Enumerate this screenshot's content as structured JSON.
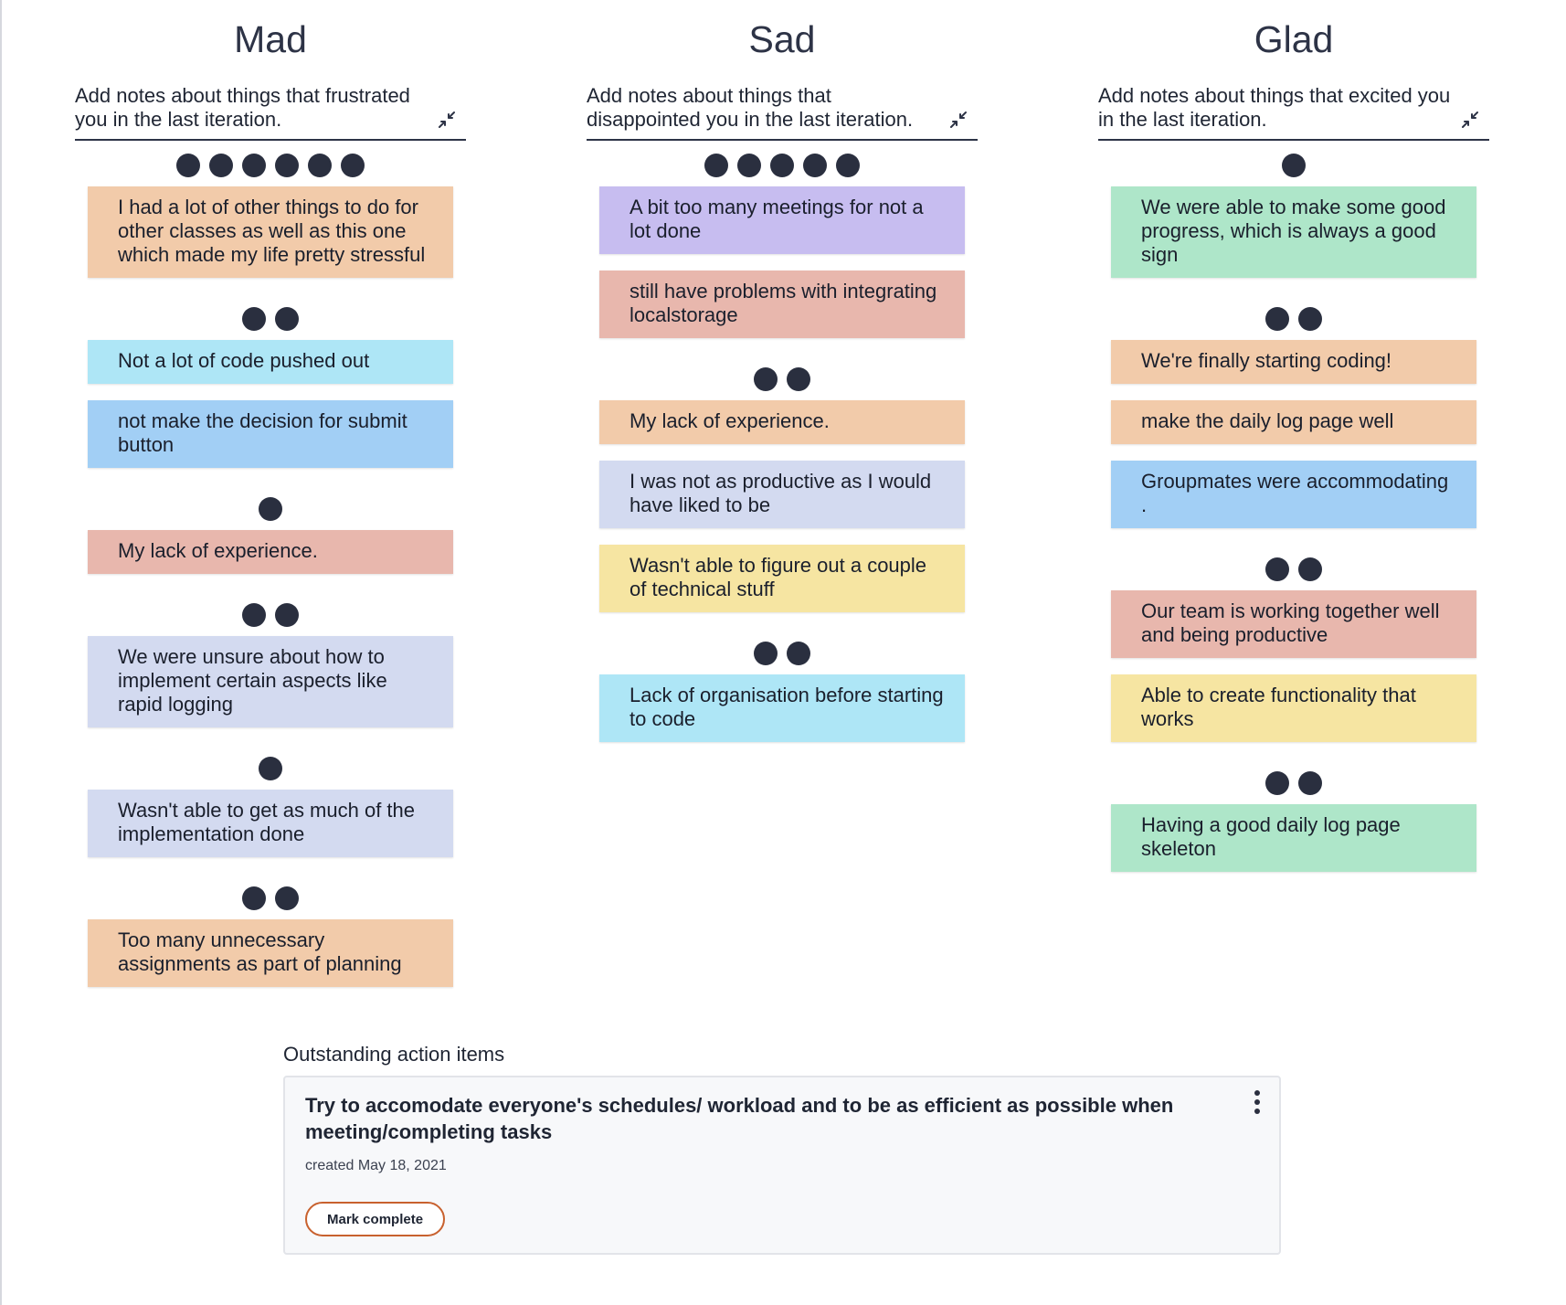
{
  "columns": [
    {
      "title": "Mad",
      "description": "Add notes about things that frustrated you in the last iteration.",
      "icon": "collapse-arrows-icon",
      "items": [
        {
          "votes": 6,
          "text": "I had a lot of other things to do for other classes as well as this one which made my life pretty stressful",
          "color": "#f2cbaa"
        },
        {
          "votes": 2,
          "text": "Not a lot of code pushed out",
          "color": "#aee6f6"
        },
        {
          "votes": 0,
          "text": "not make the decision for submit button",
          "color": "#a2cff5"
        },
        {
          "votes": 1,
          "text": "My lack of experience.",
          "color": "#e8b7ad"
        },
        {
          "votes": 2,
          "text": "We were unsure about how to implement certain aspects like rapid logging",
          "color": "#d3daf0"
        },
        {
          "votes": 1,
          "text": "Wasn't able to get as much of the implementation done",
          "color": "#d3daf0"
        },
        {
          "votes": 2,
          "text": "Too many unnecessary assignments as part of planning",
          "color": "#f2cbaa"
        }
      ]
    },
    {
      "title": "Sad",
      "description": "Add notes about things that disappointed you in the last iteration.",
      "icon": "collapse-arrows-icon",
      "items": [
        {
          "votes": 5,
          "text": "A bit too many meetings for not a lot done",
          "color": "#c7bdf0"
        },
        {
          "votes": 0,
          "text": "still have problems with integrating localstorage",
          "color": "#e8b7ad"
        },
        {
          "votes": 2,
          "text": "My lack of experience.",
          "color": "#f2cbaa"
        },
        {
          "votes": 0,
          "text": "I was not as productive as I would have liked to be",
          "color": "#d3daf0"
        },
        {
          "votes": 0,
          "text": "Wasn't able to figure out a couple of technical stuff",
          "color": "#f6e5a2"
        },
        {
          "votes": 2,
          "text": "Lack of organisation before starting to code",
          "color": "#aee6f6"
        }
      ]
    },
    {
      "title": "Glad",
      "description": "Add notes about things that excited you in the last iteration.",
      "icon": "collapse-arrows-icon",
      "items": [
        {
          "votes": 1,
          "text": "We were able to make some good progress, which is always a good sign",
          "color": "#aee6c9"
        },
        {
          "votes": 2,
          "text": "We're finally starting coding!",
          "color": "#f2cbaa"
        },
        {
          "votes": 0,
          "text": "make the daily log page well",
          "color": "#f2cbaa"
        },
        {
          "votes": 0,
          "text": "Groupmates were accommodating .",
          "color": "#a2cff5"
        },
        {
          "votes": 2,
          "text": "Our team is working together well and being productive",
          "color": "#e8b7ad"
        },
        {
          "votes": 0,
          "text": "Able to create functionality that works",
          "color": "#f6e5a2"
        },
        {
          "votes": 2,
          "text": "Having a good daily log page skeleton",
          "color": "#aee6c9"
        }
      ]
    }
  ],
  "actions": {
    "title": "Outstanding action items",
    "items": [
      {
        "text": "Try to accomodate everyone's schedules/ workload and to be as efficient as possible when meeting/completing tasks",
        "created": "created May 18, 2021",
        "button_label": "Mark complete",
        "menu_icon": "kebab-menu-icon",
        "button_border_color": "#c8612e"
      }
    ]
  }
}
